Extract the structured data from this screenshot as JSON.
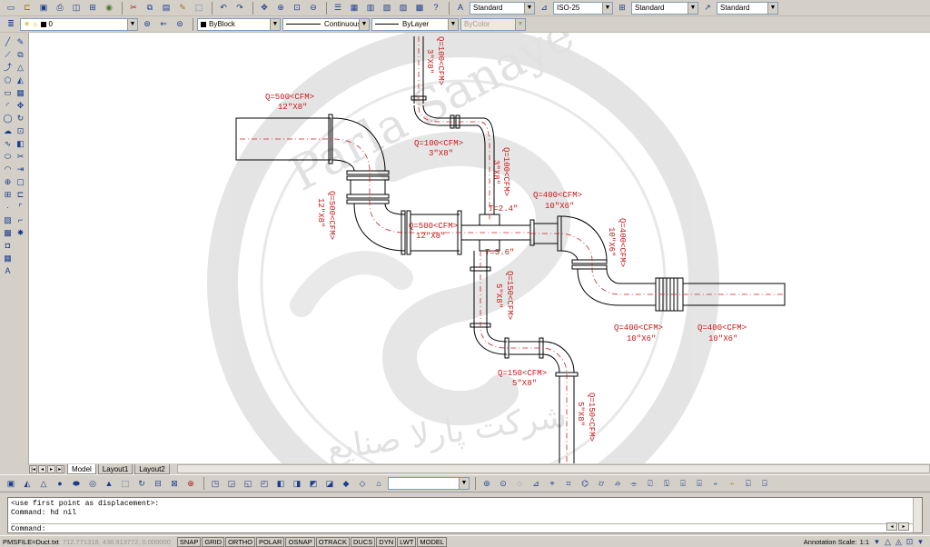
{
  "toolbar_styles": {
    "text_style": "Standard",
    "dim_style": "ISO-25",
    "table_style": "Standard",
    "multileader_style": "Standard"
  },
  "toolbar_layers": {
    "layer": "0",
    "color": "ByBlock",
    "linetype": "Continuous",
    "lineweight": "ByLayer",
    "plot_style": "ByColor"
  },
  "drawing_labels": [
    {
      "text": "Q=100<CFM>",
      "vertical": true
    },
    {
      "text": "3\"X8\"",
      "vertical": true
    },
    {
      "text": "Q=500<CFM>",
      "vertical": false
    },
    {
      "text": "12\"X8\"",
      "vertical": false
    },
    {
      "text": "Q=100<CFM>",
      "vertical": false
    },
    {
      "text": "3\"X8\"",
      "vertical": false
    },
    {
      "text": "Q=100<CFM>",
      "vertical": true
    },
    {
      "text": "3\"X8\"",
      "vertical": true
    },
    {
      "text": "Q=500<CFM>",
      "vertical": true
    },
    {
      "text": "12\"X8\"",
      "vertical": true
    },
    {
      "text": "Q=400<CFM>",
      "vertical": false
    },
    {
      "text": "10\"X6\"",
      "vertical": false
    },
    {
      "text": "T=2.4\"",
      "vertical": false
    },
    {
      "text": "Q=500<CFM>",
      "vertical": false
    },
    {
      "text": "12\"X8\"",
      "vertical": false
    },
    {
      "text": "Q=400<CFM>",
      "vertical": true
    },
    {
      "text": "10\"X6\"",
      "vertical": true
    },
    {
      "text": "T=3.6\"",
      "vertical": false
    },
    {
      "text": "Q=150<CFM>",
      "vertical": true
    },
    {
      "text": "5\"X8\"",
      "vertical": true
    },
    {
      "text": "Q=400<CFM>",
      "vertical": false
    },
    {
      "text": "10\"X6\"",
      "vertical": false
    },
    {
      "text": "Q=400<CFM>",
      "vertical": false
    },
    {
      "text": "10\"X6\"",
      "vertical": false
    },
    {
      "text": "Q=150<CFM>",
      "vertical": false
    },
    {
      "text": "5\"X8\"",
      "vertical": false
    },
    {
      "text": "Q=150<CFM>",
      "vertical": true
    },
    {
      "text": "5\"X8\"",
      "vertical": true
    }
  ],
  "watermark": {
    "text": "Parla Sanaye Co.",
    "text_fa": "شرکت پارلا صنایع"
  },
  "tabs": [
    "Model",
    "Layout1",
    "Layout2"
  ],
  "active_tab": "Model",
  "command_history": [
    "<use first point as displacement>:",
    "Command: hd nil"
  ],
  "command_prompt": "Command:",
  "status": {
    "file": "PMSFILE=Duct.txt",
    "coords": "712.771318, 438.913772, 0.000000",
    "toggles": [
      "SNAP",
      "GRID",
      "ORTHO",
      "POLAR",
      "OSNAP",
      "OTRACK",
      "DUCS",
      "DYN",
      "LWT",
      "MODEL"
    ],
    "annotation_scale_label": "Annotation Scale:",
    "annotation_scale": "1:1"
  }
}
